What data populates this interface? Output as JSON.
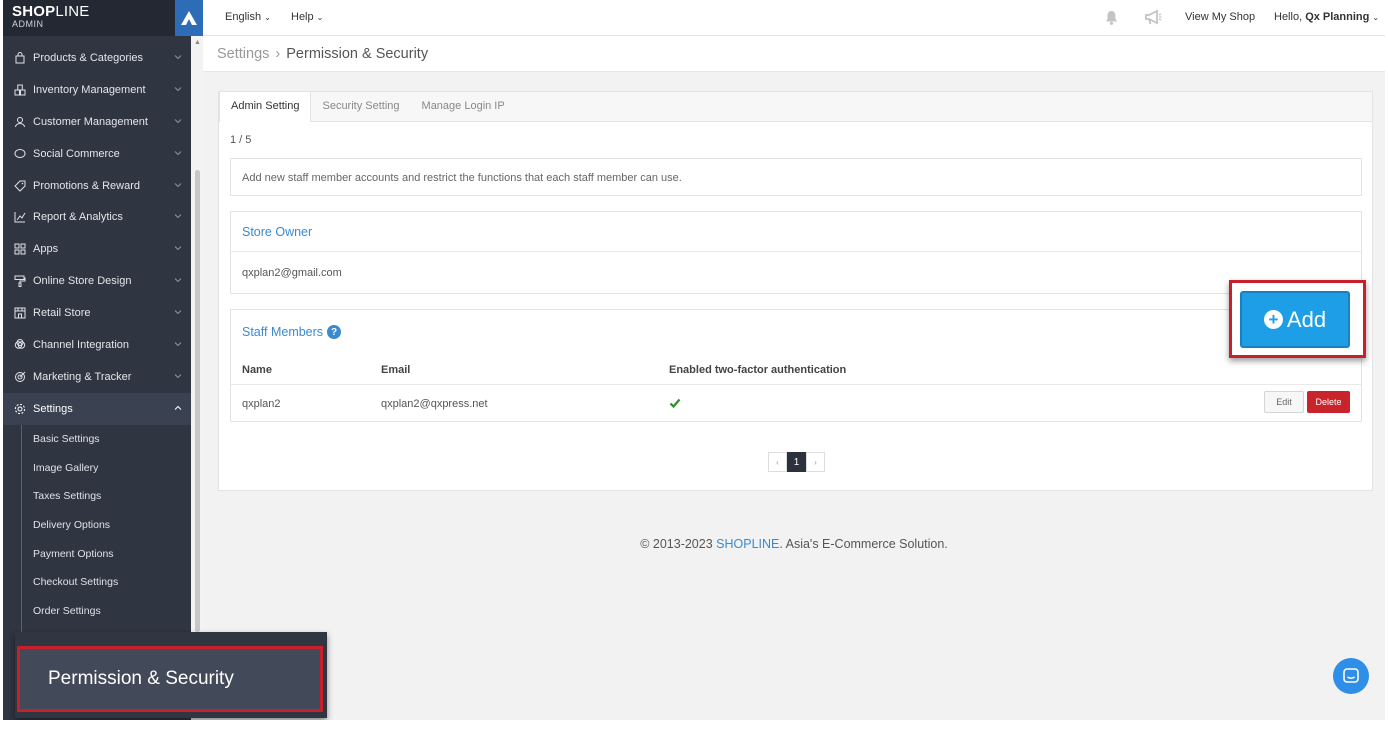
{
  "brand": {
    "name_bold": "SHOP",
    "name_light": "LINE",
    "sub": "ADMIN"
  },
  "sidebar": {
    "items": [
      {
        "label": "Products & Categories",
        "icon": "bag-icon"
      },
      {
        "label": "Inventory Management",
        "icon": "boxes-icon"
      },
      {
        "label": "Customer Management",
        "icon": "person-icon"
      },
      {
        "label": "Social Commerce",
        "icon": "chat-bubble-icon"
      },
      {
        "label": "Promotions & Reward",
        "icon": "tag-icon"
      },
      {
        "label": "Report & Analytics",
        "icon": "chart-icon"
      },
      {
        "label": "Apps",
        "icon": "apps-grid-icon"
      },
      {
        "label": "Online Store Design",
        "icon": "paint-roller-icon"
      },
      {
        "label": "Retail Store",
        "icon": "store-icon"
      },
      {
        "label": "Channel Integration",
        "icon": "channels-icon"
      },
      {
        "label": "Marketing & Tracker",
        "icon": "target-icon"
      },
      {
        "label": "Settings",
        "icon": "gear-icon"
      }
    ],
    "settings_sub": [
      "Basic Settings",
      "Image Gallery",
      "Taxes Settings",
      "Delivery Options",
      "Payment Options",
      "Checkout Settings",
      "Order Settings"
    ],
    "zoom_label": "Permission & Security"
  },
  "topbar": {
    "language": "English",
    "help": "Help",
    "view_shop": "View My Shop",
    "greeting": "Hello,",
    "user": "Qx Planning"
  },
  "breadcrumb": {
    "parent": "Settings",
    "current": "Permission & Security"
  },
  "tabs": [
    "Admin Setting",
    "Security Setting",
    "Manage Login IP"
  ],
  "pager_text": "1 / 5",
  "info_text": "Add new staff member accounts and restrict the functions that each staff member can use.",
  "owner": {
    "title": "Store Owner",
    "email": "qxplan2@gmail.com"
  },
  "staff": {
    "title": "Staff Members",
    "columns": [
      "Name",
      "Email",
      "Enabled two-factor authentication"
    ],
    "rows": [
      {
        "name": "qxplan2",
        "email": "qxplan2@qxpress.net",
        "two_factor": true
      }
    ],
    "edit_label": "Edit",
    "delete_label": "Delete"
  },
  "add_button": "Add",
  "pagination": {
    "prev": "‹",
    "current": "1",
    "next": "›"
  },
  "footer": {
    "prefix": "© 2013-2023 ",
    "brand": "SHOPLINE",
    "suffix": ". Asia's E-Commerce Solution."
  },
  "colors": {
    "sidebar": "#2f3541",
    "accent": "#3a8ad0",
    "add_button": "#1d9ee6",
    "delete": "#c9242b",
    "highlight": "#c8202b"
  }
}
